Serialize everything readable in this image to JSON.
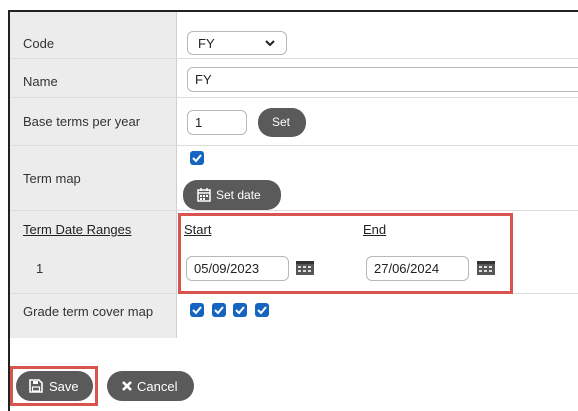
{
  "form": {
    "code": {
      "label": "Code",
      "value": "FY"
    },
    "name": {
      "label": "Name",
      "value": "FY"
    },
    "base_terms": {
      "label": "Base terms per year",
      "value": "1",
      "set_button": "Set"
    },
    "term_map": {
      "label": "Term map",
      "checked": true,
      "set_date_button": "Set date"
    },
    "term_date_ranges": {
      "label": "Term Date Ranges",
      "start_header": "Start",
      "end_header": "End",
      "rows": [
        {
          "index": "1",
          "start": "05/09/2023",
          "end": "27/06/2024"
        }
      ]
    },
    "grade_term_cover_map": {
      "label": "Grade term cover map",
      "checkboxes": [
        true,
        true,
        true,
        true
      ]
    }
  },
  "footer": {
    "save_label": "Save",
    "cancel_label": "Cancel"
  },
  "colors": {
    "accent": "#1565c0",
    "button_bg": "#5a5a5a",
    "highlight": "#d9534f",
    "label_bg": "#ececec"
  },
  "icons": [
    "chevron-down-icon",
    "check-icon",
    "calendar-icon",
    "save-icon",
    "close-icon"
  ]
}
